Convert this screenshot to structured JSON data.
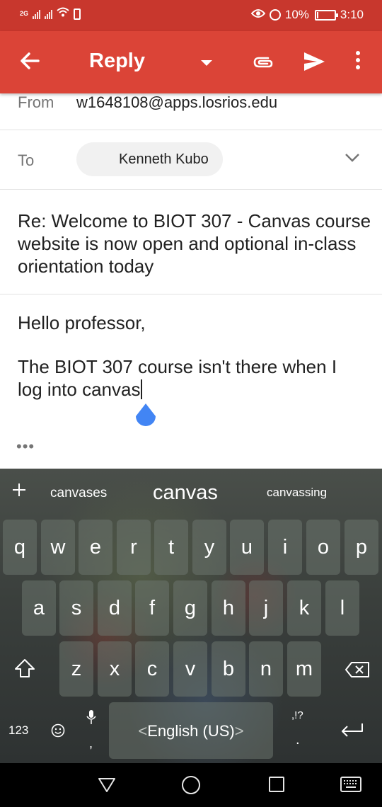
{
  "status_bar": {
    "network_tag": "2G",
    "battery_text": "10%",
    "battery_level": 0.1,
    "time": "3:10",
    "icons": [
      "signal-icon",
      "wifi-icon",
      "battery-alert-icon",
      "eye-comfort-icon",
      "alarm-icon",
      "battery-icon"
    ]
  },
  "app_bar": {
    "title": "Reply",
    "color": "#db4437",
    "icons": [
      "back-arrow-icon",
      "dropdown-icon",
      "attachment-icon",
      "send-icon",
      "more-vert-icon"
    ]
  },
  "compose": {
    "from_label": "From",
    "from_value": "w1648108@apps.losrios.edu",
    "to_label": "To",
    "to_chip": "Kenneth Kubo",
    "subject": "Re: Welcome to BIOT 307 - Canvas course website is now open and optional in-class orientation today",
    "body": {
      "greeting": "Hello professor,",
      "line1": "The BIOT 307 course isn't there when I",
      "line2": "log into canvas"
    },
    "quoted_toggle": "•••",
    "accent_color": "#4285f4"
  },
  "keyboard": {
    "suggestions": [
      "canvases",
      "canvas",
      "canvassing"
    ],
    "rows": [
      [
        "q",
        "w",
        "e",
        "r",
        "t",
        "y",
        "u",
        "i",
        "o",
        "p"
      ],
      [
        "a",
        "s",
        "d",
        "f",
        "g",
        "h",
        "j",
        "k",
        "l"
      ],
      [
        "z",
        "x",
        "c",
        "v",
        "b",
        "n",
        "m"
      ]
    ],
    "num_key": "123",
    "comma": ",",
    "space_label": "English (US)",
    "space_arrow_left": "<",
    "space_arrow_right": ">",
    "punct_hint": ",!?",
    "period": "."
  },
  "nav_bar": {
    "icons": [
      "nav-back-icon",
      "nav-home-icon",
      "nav-recents-icon",
      "nav-keyboard-icon"
    ]
  }
}
